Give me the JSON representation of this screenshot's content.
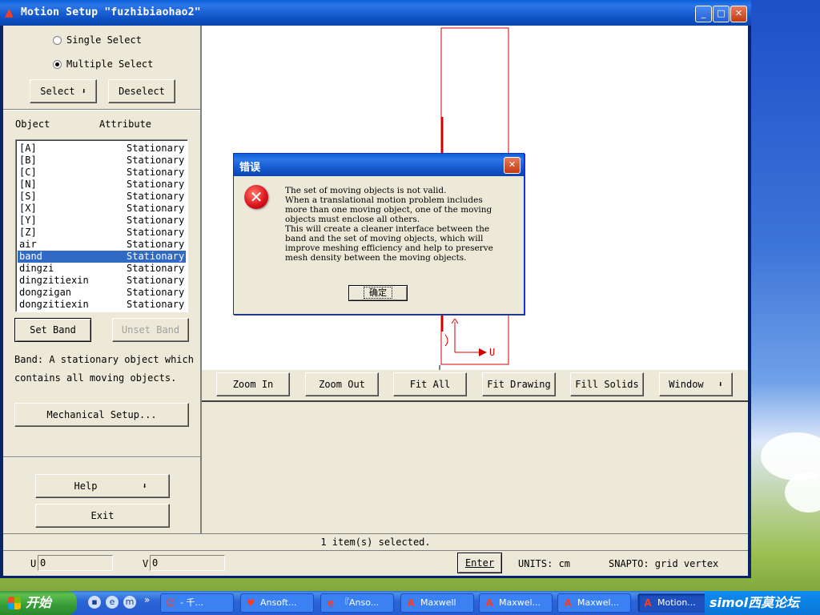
{
  "window": {
    "title": "Motion Setup \"fuzhibiaohao2\"",
    "minimize": "_",
    "maximize": "□",
    "close": "✕"
  },
  "select_mode": {
    "single": "Single Select",
    "multiple": "Multiple Select",
    "selected": "multiple"
  },
  "buttons": {
    "select": "Select",
    "deselect": "Deselect",
    "set_band": "Set Band",
    "unset_band": "Unset Band",
    "mechanical": "Mechanical Setup...",
    "help": "Help",
    "exit": "Exit",
    "enter": "Enter"
  },
  "object_list": {
    "col_object": "Object",
    "col_attribute": "Attribute",
    "rows": [
      {
        "name": "[A]",
        "attr": "Stationary"
      },
      {
        "name": "[B]",
        "attr": "Stationary"
      },
      {
        "name": "[C]",
        "attr": "Stationary"
      },
      {
        "name": "[N]",
        "attr": "Stationary"
      },
      {
        "name": "[S]",
        "attr": "Stationary"
      },
      {
        "name": "[X]",
        "attr": "Stationary"
      },
      {
        "name": "[Y]",
        "attr": "Stationary"
      },
      {
        "name": "[Z]",
        "attr": "Stationary"
      },
      {
        "name": "air",
        "attr": "Stationary"
      },
      {
        "name": "band",
        "attr": "Stationary",
        "selected": true
      },
      {
        "name": "dingzi",
        "attr": "Stationary"
      },
      {
        "name": "dingzitiexin",
        "attr": "Stationary"
      },
      {
        "name": "dongzigan",
        "attr": "Stationary"
      },
      {
        "name": "dongzitiexin",
        "attr": "Stationary"
      }
    ]
  },
  "band_help": "Band: A stationary object which contains all moving objects.",
  "zoom_toolbar": [
    "Zoom In",
    "Zoom Out",
    "Fit All",
    "Fit Drawing",
    "Fill Solids",
    "Window"
  ],
  "status": "1 item(s) selected.",
  "coords": {
    "u_label": "U",
    "u_value": "0",
    "v_label": "V",
    "v_value": "0",
    "units": "UNITS: cm",
    "snapto": "SNAPTO: grid vertex"
  },
  "canvas": {
    "axis_label": "U",
    "colors": {
      "outline": "#d40000"
    }
  },
  "dialog": {
    "title": "错误",
    "icon": "error-icon",
    "message": "The set of moving objects is not valid.\nWhen a translational motion problem includes\nmore than one moving object, one of the moving\nobjects must enclose all others.\nThis will create a cleaner interface between the\nband and the set of moving objects, which will\nimprove meshing efficiency and help to preserve\nmesh density between the moving objects.",
    "ok": "确定"
  },
  "taskbar": {
    "start": "开始",
    "chevron": "»",
    "tasks": [
      {
        "label": "- 千...",
        "icon": "☺"
      },
      {
        "label": "Ansoft...",
        "icon": "♥"
      },
      {
        "label": "『Anso...",
        "icon": "e"
      },
      {
        "label": "Maxwell",
        "icon": "A"
      },
      {
        "label": "Maxwel...",
        "icon": "A"
      },
      {
        "label": "Maxwel...",
        "icon": "A"
      },
      {
        "label": "Motion...",
        "icon": "A",
        "active": true
      }
    ],
    "tray_text": "simol西莫论坛"
  }
}
